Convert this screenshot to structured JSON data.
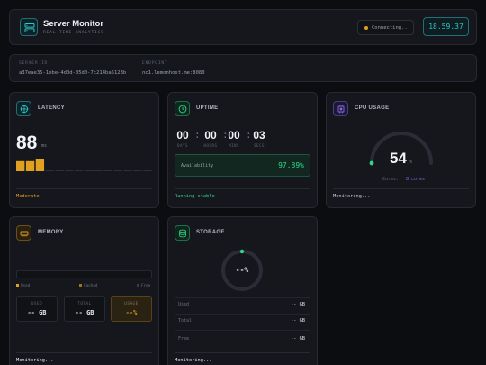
{
  "app": {
    "title": "Server Monitor",
    "subtitle": "REAL-TIME ANALYTICS",
    "status": "Connecting...",
    "clock": "18.59.37",
    "logo_icon": "server-icon"
  },
  "info": {
    "server_id_label": "SERVER ID",
    "server_id": "a37eae35-1ebe-4d0d-85d0-7c214ba5123b",
    "endpoint_label": "ENDPOINT",
    "endpoint": "nc1.lemonhost.me:8080"
  },
  "latency": {
    "title": "LATENCY",
    "icon": "crosshair-icon",
    "value": "88",
    "unit": "ms",
    "status": "Moderate",
    "history_levels": [
      0.8,
      0.8,
      1.0,
      0,
      0,
      0,
      0,
      0,
      0,
      0,
      0,
      0,
      0,
      0
    ],
    "color": "#e0a020"
  },
  "uptime": {
    "title": "UPTIME",
    "icon": "clock-icon",
    "days": "00",
    "hours": "00",
    "mins": "00",
    "secs": "03",
    "days_label": "DAYS",
    "hours_label": "HOURS",
    "mins_label": "MINS",
    "secs_label": "SECS",
    "availability_label": "Availability",
    "availability": "97.89%",
    "status": "Running stable",
    "color": "#2fd68a"
  },
  "cpu": {
    "title": "CPU USAGE",
    "icon": "cpu-icon",
    "value": "54",
    "unit": "%",
    "usage_fraction": 0.54,
    "cores_label": "Cores:",
    "cores": "8 cores",
    "status": "Monitoring...",
    "color": "#8a68e8"
  },
  "memory": {
    "title": "MEMORY",
    "icon": "memory-icon",
    "legend": [
      "Used",
      "Cached",
      "Free"
    ],
    "used_label": "USED",
    "used": "-- GB",
    "total_label": "TOTAL",
    "total": "-- GB",
    "usage_label": "USAGE",
    "usage": "--%",
    "status": "Monitoring...",
    "color": "#e0a020"
  },
  "storage": {
    "title": "STORAGE",
    "icon": "database-icon",
    "percent": "--%",
    "rows": [
      {
        "label": "Used",
        "value": "-- GB"
      },
      {
        "label": "Total",
        "value": "-- GB"
      },
      {
        "label": "Free",
        "value": "-- GB"
      }
    ],
    "status": "Monitoring...",
    "color": "#2fd68a"
  }
}
